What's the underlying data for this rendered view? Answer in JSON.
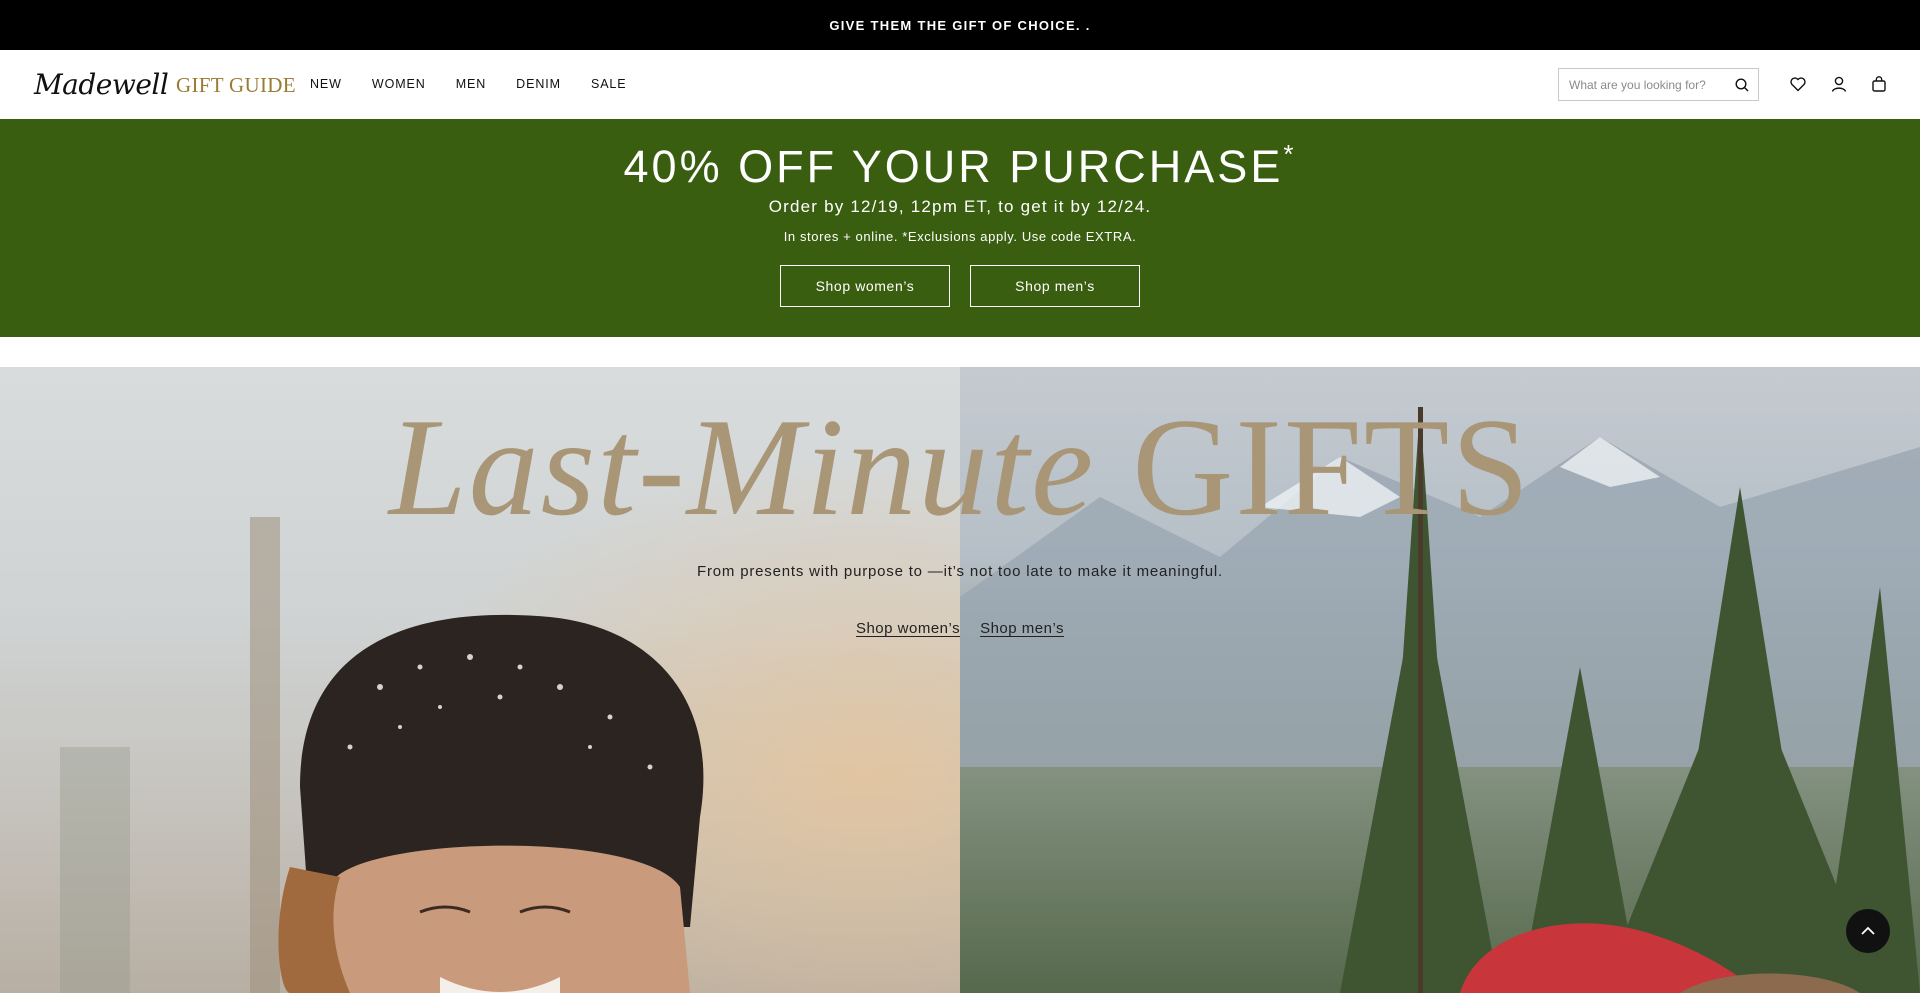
{
  "announcement": {
    "text": "GIVE THEM THE GIFT OF CHOICE. ."
  },
  "header": {
    "logo_text": "Madewell",
    "gift_guide_label": "GIFT GUIDE",
    "nav": [
      "NEW",
      "WOMEN",
      "MEN",
      "DENIM",
      "SALE"
    ],
    "search": {
      "placeholder": "What are you looking for?",
      "value": ""
    },
    "icons": [
      "heart-icon",
      "account-icon",
      "bag-icon"
    ]
  },
  "promo": {
    "headline": "40% OFF YOUR PURCHASE",
    "headline_mark": "*",
    "subheading": "Order by 12/19, 12pm ET, to get it by 12/24.",
    "fine_print": "In stores + online. *Exclusions apply. Use code EXTRA.",
    "buttons": [
      "Shop women’s",
      "Shop men’s"
    ],
    "background_color": "#3a5e10"
  },
  "hero": {
    "title_italic": "Last-Minute",
    "title_plain": "GIFTS",
    "tagline": "From presents with purpose to —it’s not too late to make it meaningful.",
    "links": [
      "Shop women’s",
      "Shop men’s"
    ],
    "title_color": "#a89676"
  },
  "scroll_top": {
    "icon": "chevron-up-icon"
  }
}
